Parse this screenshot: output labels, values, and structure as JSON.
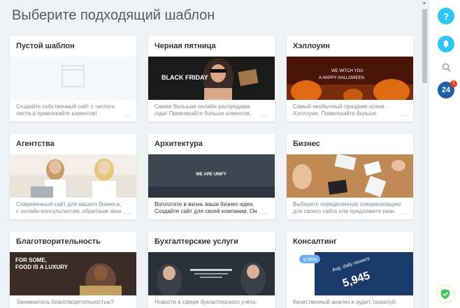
{
  "page": {
    "title": "Выберите подходящий шаблон"
  },
  "templates": [
    {
      "title": "Пустой шаблон",
      "desc": "Создайте собственный сайт с чистого листа и привлекайте клиентов!"
    },
    {
      "title": "Черная пятница",
      "desc": "Самая большая онлайн-распродажа года! Привлекайте больше клиентов, сделав",
      "image_text": "BLACK FRIDAY"
    },
    {
      "title": "Хэллоуин",
      "desc": "Самый необычный праздник осени - Хэллоуин. Привлекайте больше",
      "image_text": "WE WITCH YOU A HAPPY HALLOWEEN"
    },
    {
      "title": "Агентства",
      "desc": "Современный сайт для вашего бизнеса, с онлайн-консультантом, обратным звон"
    },
    {
      "title": "Архитектура",
      "desc": "Воплотите в жизнь ваши бизнес-идеи. Создайте сайт для своей компании. Он",
      "image_text": "WE ARE UNIFY"
    },
    {
      "title": "Бизнес",
      "desc": "Выберите определенную специализацию для своего сайта или предложите разн"
    },
    {
      "title": "Благотворительность",
      "desc": "Занимаетесь благотворительностью?",
      "image_text": "FOR SOME, FOOD IS A LUXURY"
    },
    {
      "title": "Бухгалтерские услуги",
      "desc": "Новости в сфере бухгалтерского учета,"
    },
    {
      "title": "Консалтинг",
      "desc": "Качественный анализ и аудит, пожалуй,",
      "image_text": "Avg. daily viewers 5,945"
    }
  ],
  "more_label": "...",
  "rightbar": {
    "help_label": "?",
    "b24_label": "24",
    "notification_count": "1"
  },
  "colors": {
    "accent": "#2fc6f6",
    "brand": "#1e5fa8",
    "background": "#eef2f4"
  }
}
